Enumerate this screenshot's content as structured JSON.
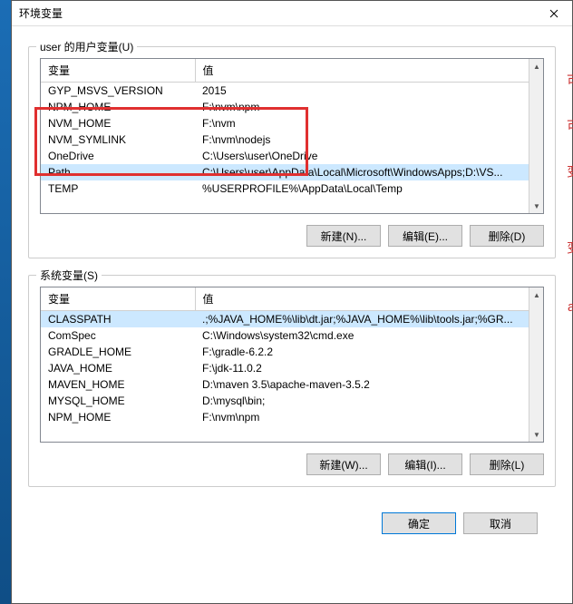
{
  "window": {
    "title": "环境变量"
  },
  "user_section": {
    "label": "user 的用户变量(U)",
    "columns": {
      "name": "变量",
      "value": "值"
    },
    "rows": [
      {
        "name": "GYP_MSVS_VERSION",
        "value": "2015"
      },
      {
        "name": "NPM_HOME",
        "value": "F:\\nvm\\npm"
      },
      {
        "name": "NVM_HOME",
        "value": "F:\\nvm"
      },
      {
        "name": "NVM_SYMLINK",
        "value": "F:\\nvm\\nodejs"
      },
      {
        "name": "OneDrive",
        "value": "C:\\Users\\user\\OneDrive"
      },
      {
        "name": "Path",
        "value": "C:\\Users\\user\\AppData\\Local\\Microsoft\\WindowsApps;D:\\VS..."
      },
      {
        "name": "TEMP",
        "value": "%USERPROFILE%\\AppData\\Local\\Temp"
      }
    ],
    "buttons": {
      "new": "新建(N)...",
      "edit": "编辑(E)...",
      "delete": "删除(D)"
    }
  },
  "system_section": {
    "label": "系统变量(S)",
    "columns": {
      "name": "变量",
      "value": "值"
    },
    "rows": [
      {
        "name": "CLASSPATH",
        "value": ".;%JAVA_HOME%\\lib\\dt.jar;%JAVA_HOME%\\lib\\tools.jar;%GR..."
      },
      {
        "name": "ComSpec",
        "value": "C:\\Windows\\system32\\cmd.exe"
      },
      {
        "name": "GRADLE_HOME",
        "value": "F:\\gradle-6.2.2"
      },
      {
        "name": "JAVA_HOME",
        "value": "F:\\jdk-11.0.2"
      },
      {
        "name": "MAVEN_HOME",
        "value": "D:\\maven 3.5\\apache-maven-3.5.2"
      },
      {
        "name": "MYSQL_HOME",
        "value": "D:\\mysql\\bin;"
      },
      {
        "name": "NPM_HOME",
        "value": "F:\\nvm\\npm"
      }
    ],
    "buttons": {
      "new": "新建(W)...",
      "edit": "编辑(I)...",
      "delete": "删除(L)"
    }
  },
  "dialog_buttons": {
    "ok": "确定",
    "cancel": "取消"
  },
  "sidechars": {
    "a": "可",
    "b": "可",
    "c": "变",
    "d": "变",
    "e": "a"
  }
}
